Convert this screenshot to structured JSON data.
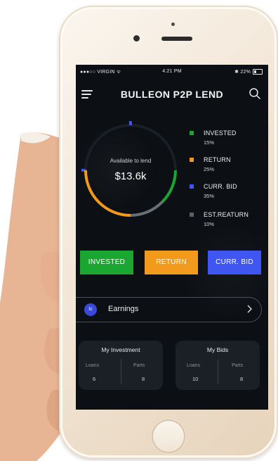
{
  "status_bar": {
    "carrier": "●●●○○ VIRGIN ᯤ",
    "time": "4:21 PM",
    "battery": "✱ 22%"
  },
  "header": {
    "title": "BULLEON P2P LEND",
    "menu_icon": "hamburger-menu-icon",
    "search_icon": "search-icon"
  },
  "summary": {
    "available_label": "Available to lend",
    "available_value": "$13.6k"
  },
  "legend": [
    {
      "name": "INVESTED",
      "pct": "15%",
      "color": "#1aa631"
    },
    {
      "name": "RETURN",
      "pct": "25%",
      "color": "#f29a1c"
    },
    {
      "name": "CURR. BID",
      "pct": "35%",
      "color": "#3f56f2"
    },
    {
      "name": "EST.REATURN",
      "pct": "10%",
      "color": "#5b5f66"
    }
  ],
  "buttons": {
    "invested": "INVESTED",
    "return": "RETURN",
    "curr_bid": "CURR. BID"
  },
  "earnings": {
    "badge": "Ic",
    "label": "Earnings",
    "chevron_icon": "chevron-right-icon"
  },
  "my_investment": {
    "title": "My Investment",
    "loans_label": "Loans",
    "loans_value": "6",
    "parts_label": "Parts",
    "parts_value": "8"
  },
  "my_bids": {
    "title": "My Bids",
    "loans_label": "Loans",
    "loans_value": "10",
    "parts_label": "Parts",
    "parts_value": "8"
  }
}
